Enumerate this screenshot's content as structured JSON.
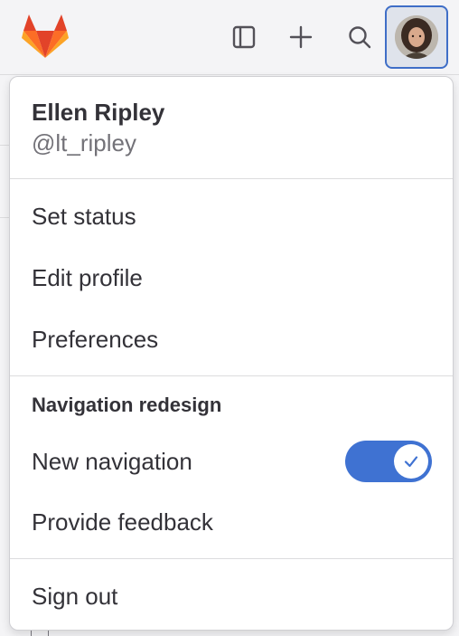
{
  "topbar": {
    "logo_icon": "gitlab-tanuki-logo",
    "sidebar_icon": "sidebar-toggle-icon",
    "plus_icon": "plus-icon",
    "search_icon": "search-icon",
    "avatar_icon": "user-avatar"
  },
  "user_menu": {
    "name": "Ellen Ripley",
    "handle": "@lt_ripley",
    "items": [
      {
        "label": "Set status"
      },
      {
        "label": "Edit profile"
      },
      {
        "label": "Preferences"
      }
    ],
    "navigation_section": {
      "title": "Navigation redesign",
      "new_navigation_label": "New navigation",
      "new_navigation_enabled": true,
      "feedback_label": "Provide feedback"
    },
    "sign_out_label": "Sign out"
  },
  "colors": {
    "accent": "#3f72d2",
    "focus_ring": "#3f6ec7",
    "logo_orange": "#e24329",
    "logo_light_orange": "#fca326"
  }
}
